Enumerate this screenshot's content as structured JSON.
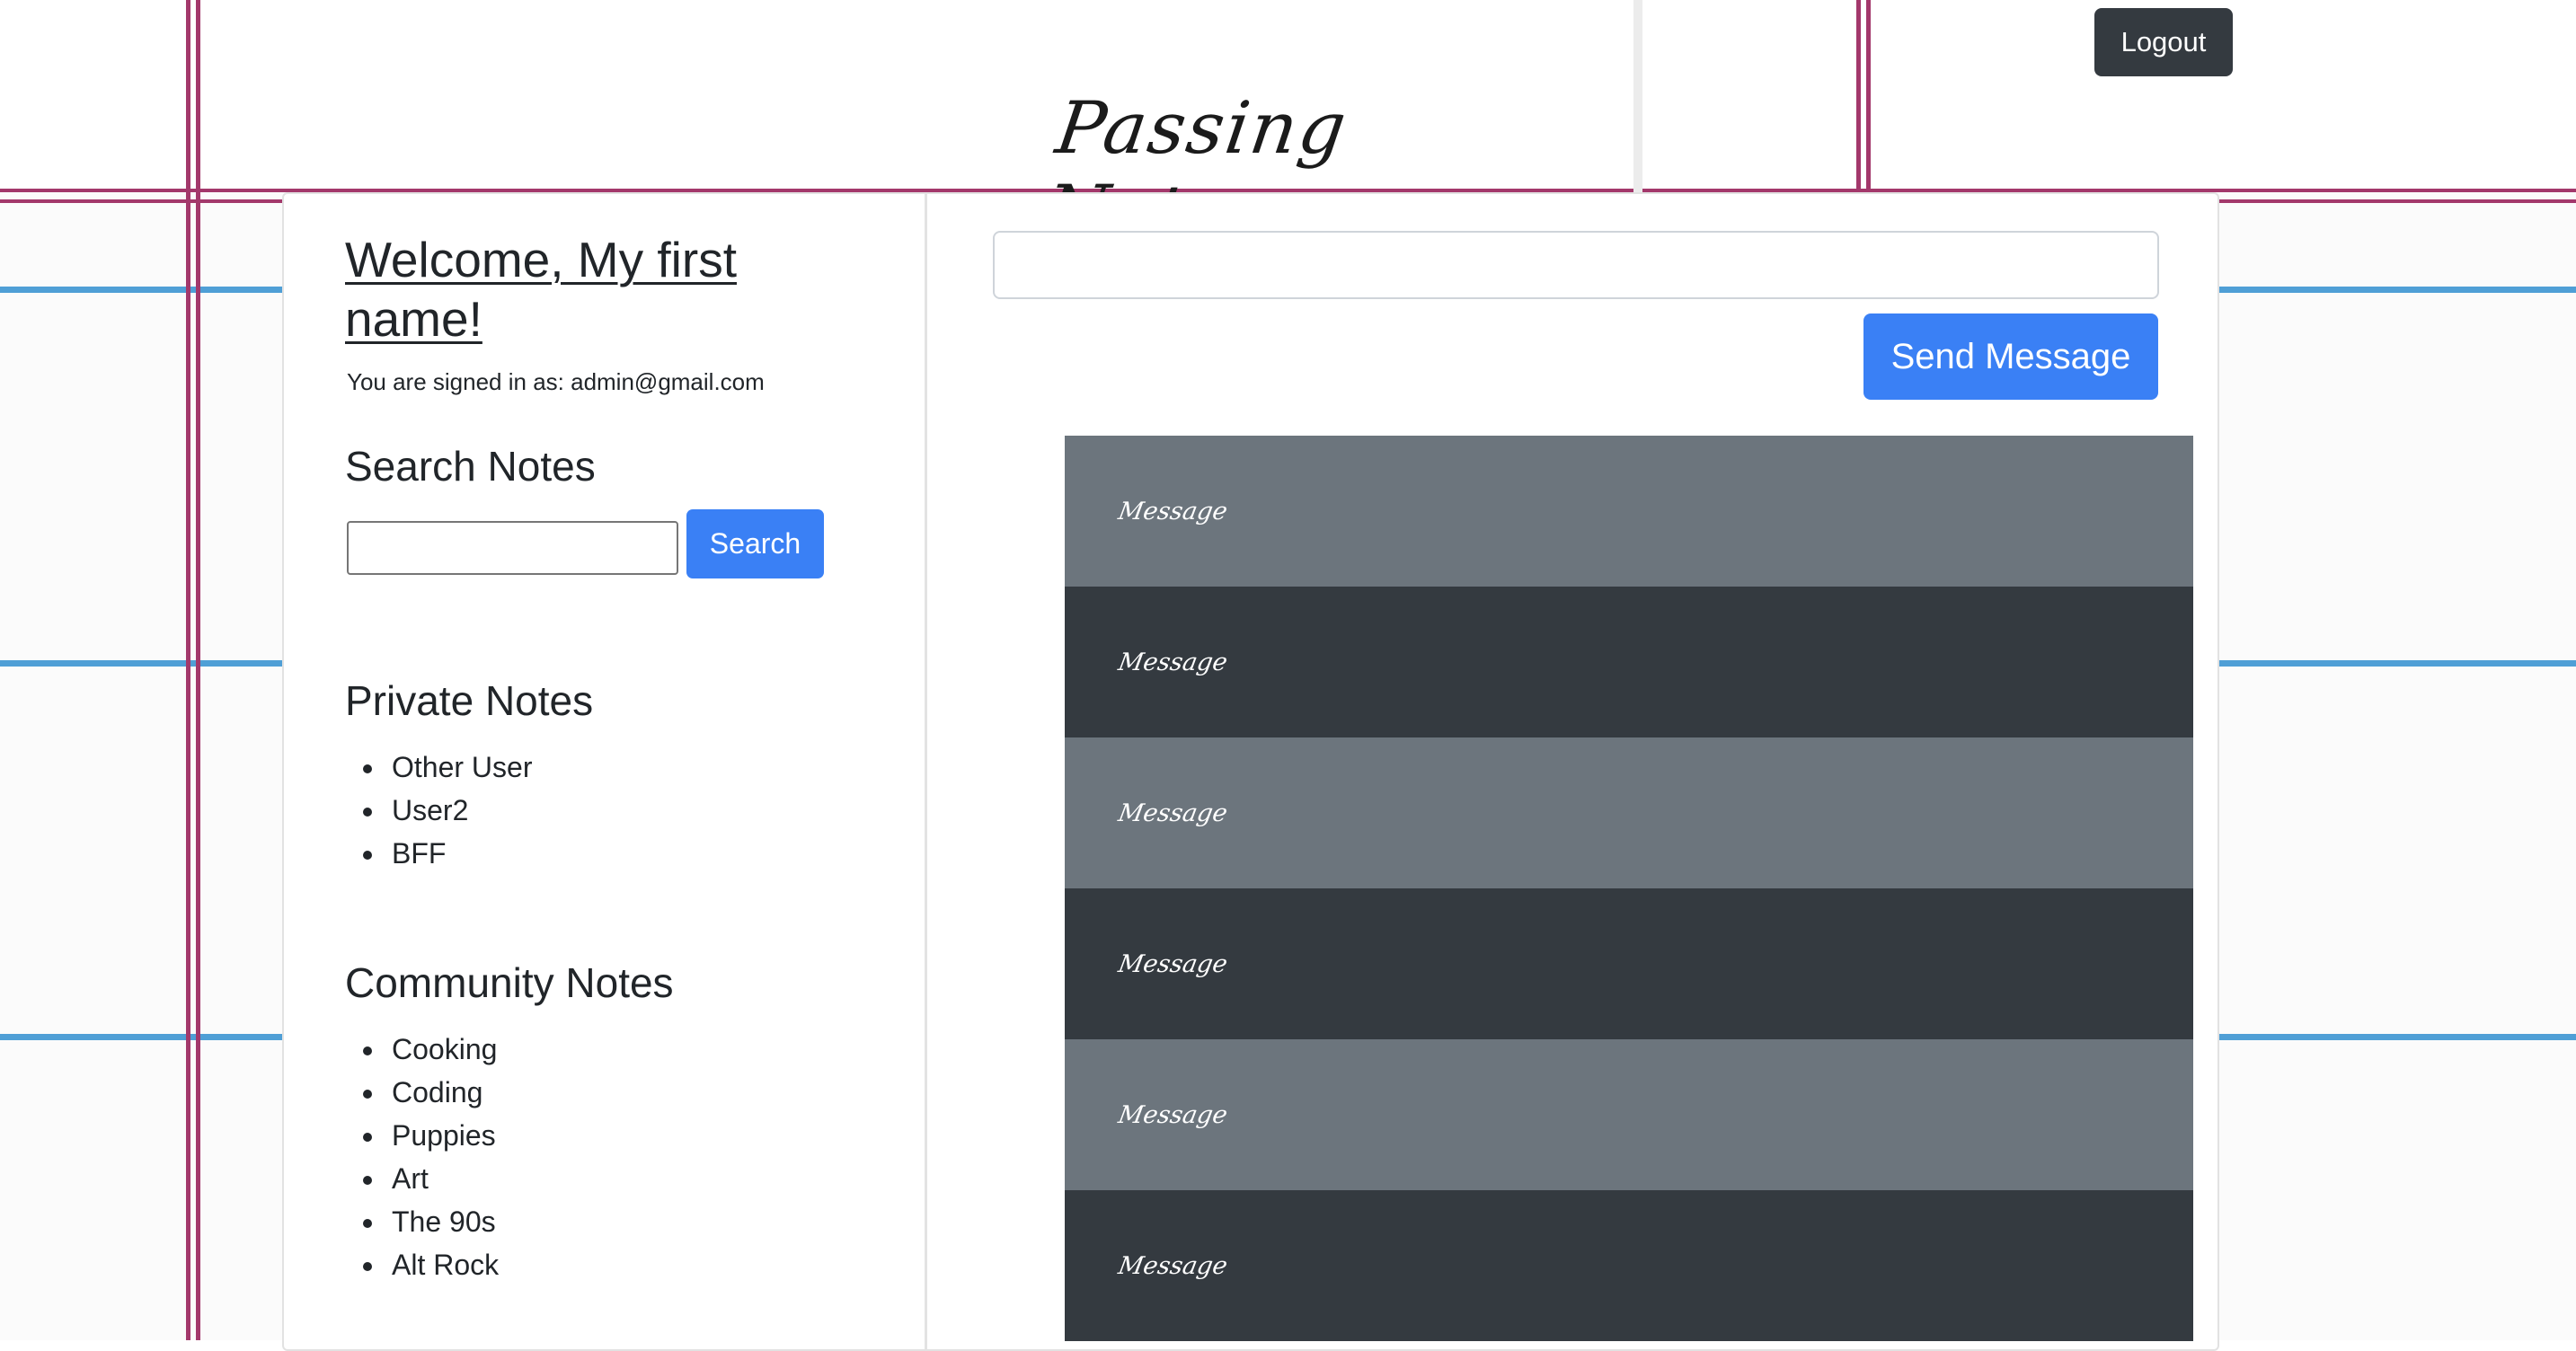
{
  "header": {
    "brand": "Passing Notes",
    "logout_label": "Logout"
  },
  "sidebar": {
    "welcome": "Welcome, My first name!",
    "signed_in": "You are signed in as: admin@gmail.com",
    "search": {
      "heading": "Search Notes",
      "value": "",
      "placeholder": "",
      "button_label": "Search"
    },
    "private_notes": {
      "heading": "Private Notes",
      "items": [
        "Other User",
        "User2",
        "BFF"
      ]
    },
    "community_notes": {
      "heading": "Community Notes",
      "items": [
        "Cooking",
        "Coding",
        "Puppies",
        "Art",
        "The 90s",
        "Alt Rock"
      ]
    }
  },
  "composer": {
    "value": "",
    "placeholder": "",
    "send_label": "Send Message"
  },
  "messages": [
    "Message",
    "Message",
    "Message",
    "Message",
    "Message",
    "Message"
  ],
  "colors": {
    "primary": "#3a80f5",
    "dark": "#343a40",
    "secondary": "#6c757d",
    "margin_line": "#a3386b",
    "ruled_line": "#4f9fd6"
  }
}
